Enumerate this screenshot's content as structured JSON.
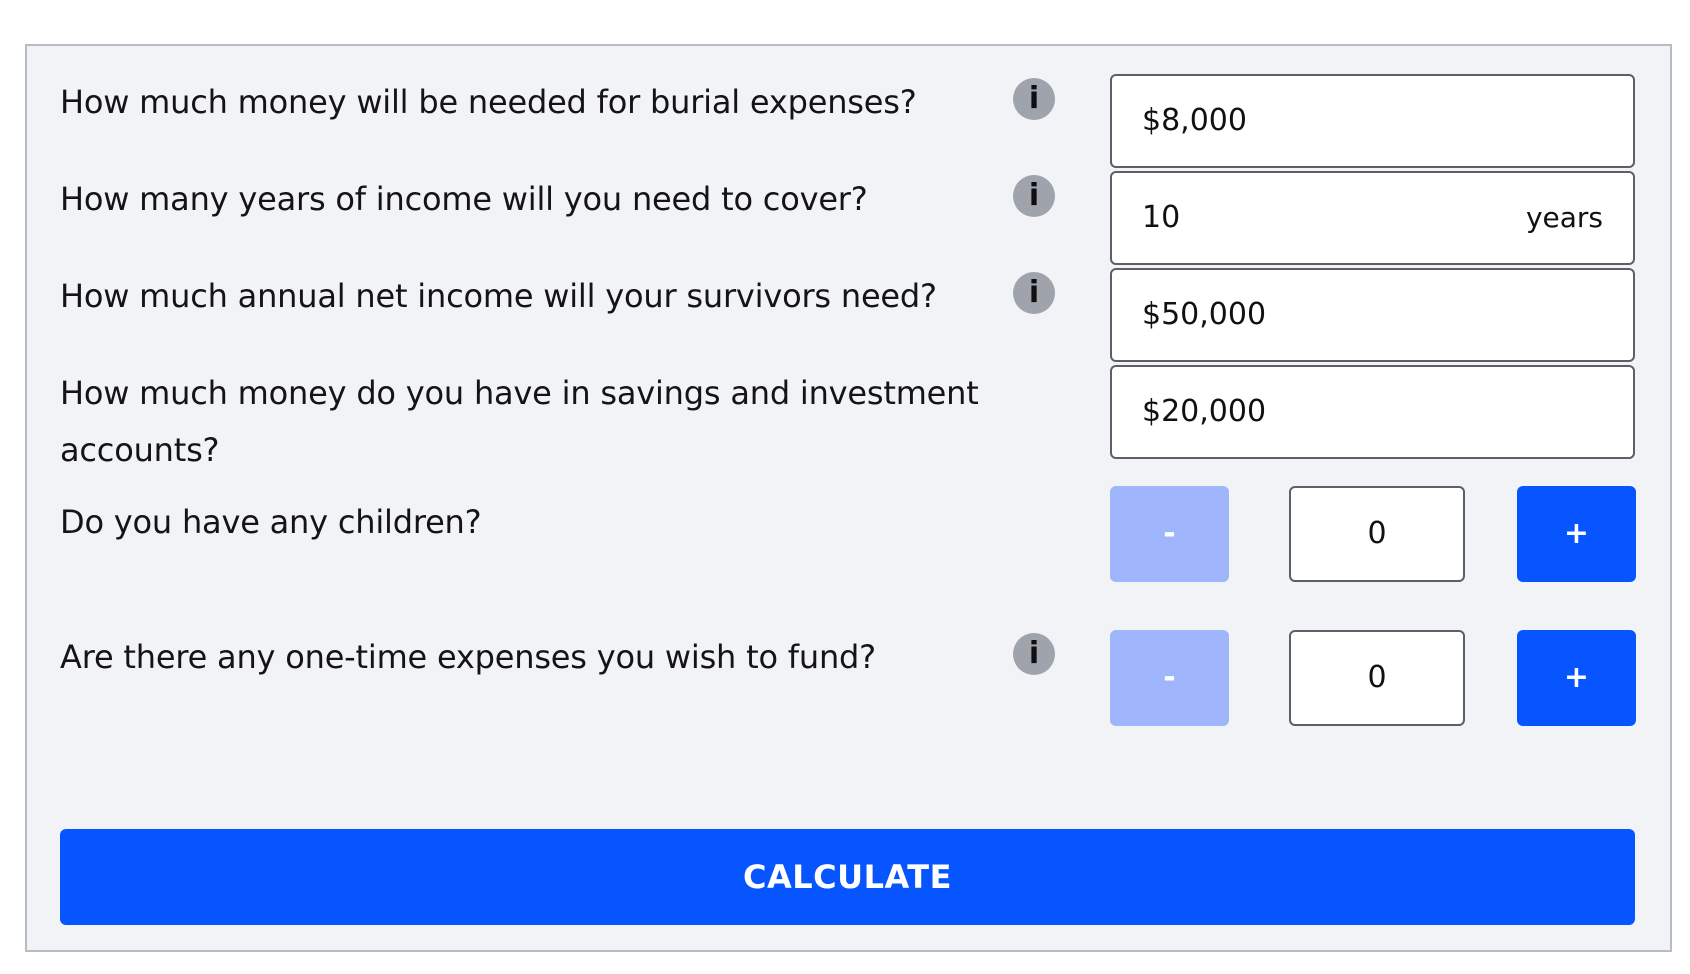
{
  "questions": {
    "burial": {
      "label": "How much money will be needed for burial expenses?",
      "value": "$8,000",
      "info_icon": "info-icon"
    },
    "years": {
      "label": "How many years of income will you need to cover?",
      "value": "10",
      "suffix": "years",
      "info_icon": "info-icon"
    },
    "income": {
      "label": "How much annual net income will your survivors need?",
      "value": "$50,000",
      "info_icon": "info-icon"
    },
    "savings": {
      "label_line1": "How much money do you have in savings and investment",
      "label_line2": "accounts?",
      "value": "$20,000"
    },
    "children": {
      "label": "Do you have any children?",
      "minus_label": "-",
      "value": "0",
      "plus_label": "+"
    },
    "one_time": {
      "label": "Are there any one-time expenses you wish to fund?",
      "minus_label": "-",
      "value": "0",
      "plus_label": "+",
      "info_icon": "info-icon"
    }
  },
  "actions": {
    "calculate_label": "CALCULATE"
  },
  "info_glyph": "i",
  "colors": {
    "panel_bg": "#f1f3f7",
    "accent": "#0655ff",
    "accent_disabled": "#9fb6fd",
    "info_icon_bg": "#9ea3ac"
  }
}
